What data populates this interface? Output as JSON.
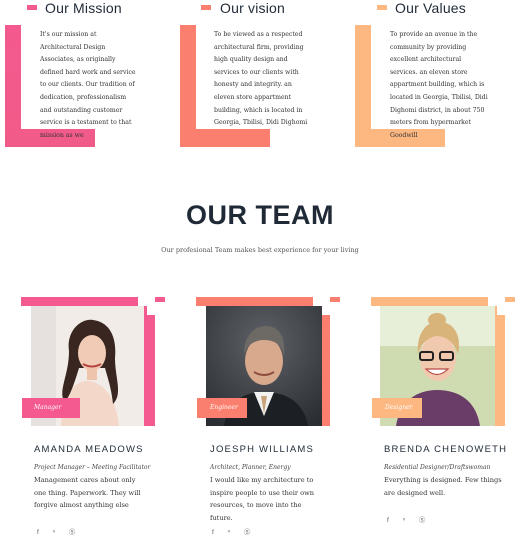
{
  "colors": {
    "pink": "#f4598f",
    "coral": "#fa7f6e",
    "peach": "#fdb882",
    "dark": "#1f2a36"
  },
  "mission": {
    "title": "Our Mission",
    "text": "It's our mission at Architectural Design Associates, as originally defined hard work and service to our clients. Our tradition of dedication, professionalism and outstanding customer service is a testament to that mission as we"
  },
  "vision": {
    "title": "Our vision",
    "text": "To be viewed as a respected architectural firm, providing high quality design and services to our clients with honesty and integrity. an eleven store appartment building, which is located in Georgia, Tbilisi, Didi Dighomi"
  },
  "values": {
    "title": "Our Values",
    "text": "To provide an avenue in the community  by providing excellent architectural services.  an eleven store appartment building, which is located in Georgia, Tbilisi, Didi Dighomi district, in about 750 meters from hypermarket Goodwill"
  },
  "team": {
    "title": "OUR TEAM",
    "subtitle": "Our profesional Team makes best experience for your living",
    "members": [
      {
        "tag": "Manager",
        "name": "AMANDA MEADOWS",
        "role": "Project Manager – Meeting Facilitator",
        "desc": "Management cares about only one thing. Paperwork. They will forgive almost anything else",
        "social": [
          "f",
          "ᵛ",
          "Ⓢ"
        ]
      },
      {
        "tag": "Engineer",
        "name": "JOESPH WILLIAMS",
        "role": "Architect, Planner, Energy",
        "desc": "I would like my architecture to inspire people to use their own resources, to move into the future.",
        "social": [
          "f",
          "ᵛ",
          "Ⓢ"
        ]
      },
      {
        "tag": "Designer",
        "name": "BRENDA CHENOWETH",
        "role": "Residential Designer/Draftswoman",
        "desc": "Everything is designed. Few things are designed well.",
        "social": [
          "f",
          "ᵛ",
          "Ⓢ"
        ]
      }
    ]
  }
}
